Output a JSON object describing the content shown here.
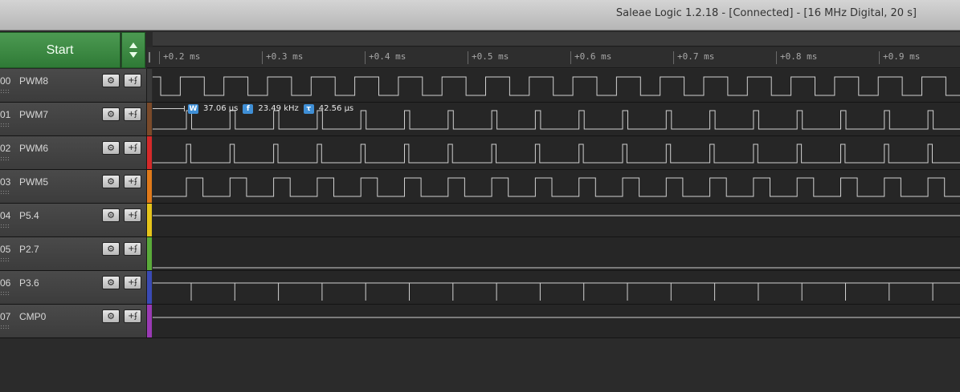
{
  "window": {
    "title": "Saleae Logic 1.2.18 - [Connected] - [16 MHz Digital, 20 s]"
  },
  "start_button": {
    "label": "Start"
  },
  "ruler": {
    "ticks": [
      "+0.2 ms",
      "+0.3 ms",
      "+0.4 ms",
      "+0.5 ms",
      "+0.6 ms",
      "+0.7 ms",
      "+0.8 ms",
      "+0.9 ms"
    ]
  },
  "measurement": {
    "width_icon": "W",
    "width": "37.06 µs",
    "freq_icon": "f",
    "frequency": "23.49 kHz",
    "period_icon": "τ",
    "period": "42.56 µs"
  },
  "channel_button_icons": {
    "settings": "gear-icon",
    "trigger": "trigger-icon"
  },
  "channels": [
    {
      "num": "00",
      "name": "PWM8",
      "color": "#3a3a3a",
      "signal": "square",
      "duty": 0.45
    },
    {
      "num": "01",
      "name": "PWM7",
      "color": "#7a4a2a",
      "signal": "pulse",
      "duty": 0.12
    },
    {
      "num": "02",
      "name": "PWM6",
      "color": "#d42a2a",
      "signal": "pulse",
      "duty": 0.1
    },
    {
      "num": "03",
      "name": "PWM5",
      "color": "#e07a1a",
      "signal": "pulse",
      "duty": 0.38
    },
    {
      "num": "04",
      "name": "P5.4",
      "color": "#e6c41a",
      "signal": "high"
    },
    {
      "num": "05",
      "name": "P2.7",
      "color": "#5aaa3a",
      "signal": "low"
    },
    {
      "num": "06",
      "name": "P3.6",
      "color": "#3a4ab4",
      "signal": "spikes"
    },
    {
      "num": "07",
      "name": "CMP0",
      "color": "#9a3ab4",
      "signal": "high"
    }
  ]
}
